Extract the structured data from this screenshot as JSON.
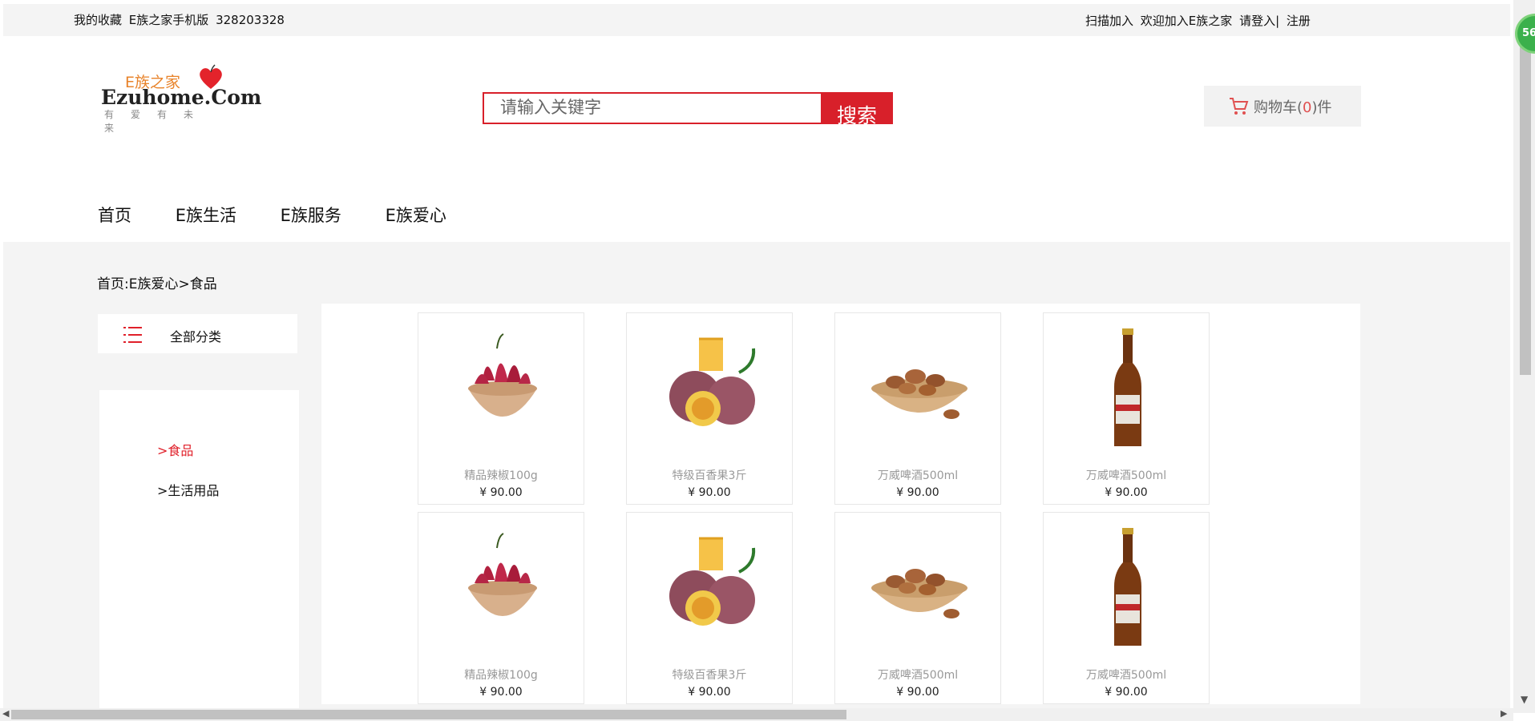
{
  "topbar": {
    "favorites": "我的收藏",
    "mobile": "E族之家手机版",
    "qq": "328203328",
    "scan": "扫描加入",
    "welcome": "欢迎加入E族之家",
    "login": "请登入|",
    "register": "注册"
  },
  "logo": {
    "cn": "E族之家",
    "en": "Ezuhome.Com",
    "slogan": "有爱有未来"
  },
  "search": {
    "placeholder": "请输入关键字",
    "button": "搜索"
  },
  "cart": {
    "label_prefix": "购物车(",
    "count": "0",
    "label_suffix": ")件"
  },
  "nav": [
    "首页",
    "E族生活",
    "E族服务",
    "E族爱心"
  ],
  "breadcrumb": "首页:E族爱心>食品",
  "all_categories": "全部分类",
  "categories": [
    {
      "label": ">食品",
      "active": true
    },
    {
      "label": ">生活用品",
      "active": false
    }
  ],
  "products": [
    {
      "name": "精品辣椒100g",
      "price": "¥ 90.00",
      "image": "chili-bowl"
    },
    {
      "name": "特级百香果3斤",
      "price": "¥ 90.00",
      "image": "passion-fruit"
    },
    {
      "name": "万威啤酒500ml",
      "price": "¥ 90.00",
      "image": "almond-bowl"
    },
    {
      "name": "万威啤酒500ml",
      "price": "¥ 90.00",
      "image": "beer-bottle"
    },
    {
      "name": "精品辣椒100g",
      "price": "¥ 90.00",
      "image": "chili-bowl"
    },
    {
      "name": "特级百香果3斤",
      "price": "¥ 90.00",
      "image": "passion-fruit"
    },
    {
      "name": "万威啤酒500ml",
      "price": "¥ 90.00",
      "image": "almond-bowl"
    },
    {
      "name": "万威啤酒500ml",
      "price": "¥ 90.00",
      "image": "beer-bottle"
    }
  ],
  "badge": "56",
  "colors": {
    "accent": "#d8202a",
    "logo_orange": "#e8832a",
    "gray_bg": "#f4f4f4"
  }
}
